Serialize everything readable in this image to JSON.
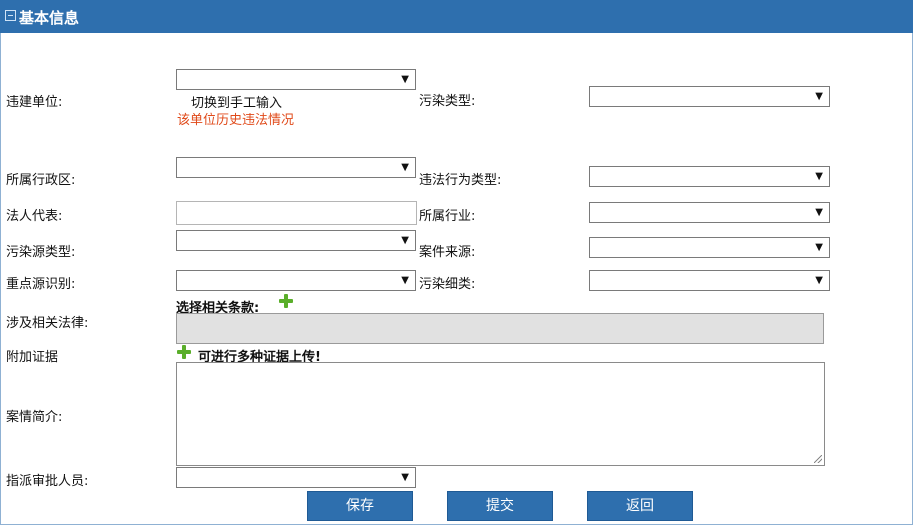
{
  "header": {
    "title": "基本信息"
  },
  "left": {
    "unit_label": "违建单位:",
    "switch_manual": "切换到手工输入",
    "history_link": "该单位历史违法情况",
    "district_label": "所属行政区:",
    "legal_rep_label": "法人代表:",
    "legal_rep_value": "",
    "source_type_label": "污染源类型:",
    "key_source_label": "重点源识别:",
    "law_label": "涉及相关法律:",
    "evidence_label": "附加证据",
    "summary_label": "案情简介:",
    "approver_label": "指派审批人员:"
  },
  "right": {
    "pollution_type_label": "污染类型:",
    "violation_type_label": "违法行为类型:",
    "industry_label": "所属行业:",
    "case_source_label": "案件来源:",
    "pollution_sub_label": "污染细类:"
  },
  "selects": {
    "unit": "",
    "district": "",
    "source_type": "",
    "key_source": "",
    "approver": "",
    "pollution_type": "",
    "violation_type": "",
    "industry": "",
    "case_source": "",
    "pollution_sub": ""
  },
  "law": {
    "select_clause": "选择相关条款:"
  },
  "evidence": {
    "upload_hint": "可进行多种证据上传!"
  },
  "summary": {
    "value": ""
  },
  "buttons": {
    "save": "保存",
    "submit": "提交",
    "back": "返回"
  },
  "colors": {
    "header": "#2e6fae",
    "button": "#2e6fae",
    "link": "#e04a1a",
    "plus": "#5aae2a"
  },
  "icons": {
    "select_arrow": "▼"
  }
}
